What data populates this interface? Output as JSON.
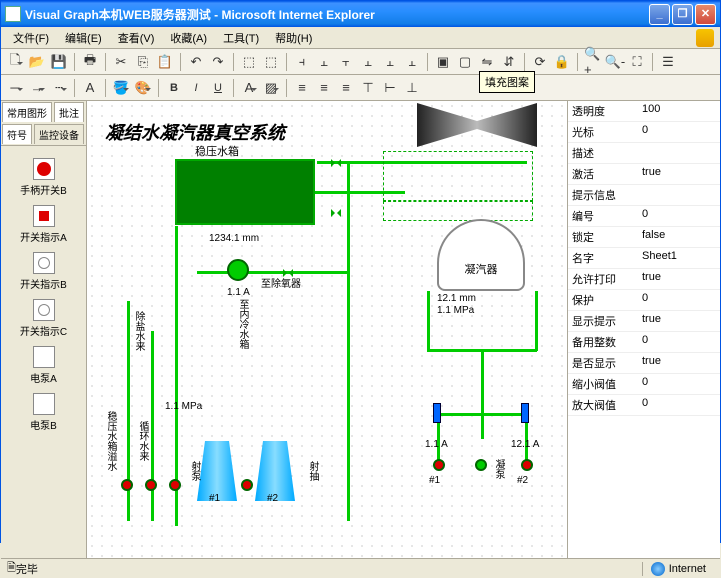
{
  "window": {
    "title": "Visual Graph本机WEB服务器测试 - Microsoft Internet Explorer"
  },
  "menu": {
    "file": "文件(F)",
    "edit": "编辑(E)",
    "view": "查看(V)",
    "fav": "收藏(A)",
    "tools": "工具(T)",
    "help": "帮助(H)"
  },
  "tooltip": "填充图案",
  "tabs": {
    "t1": "常用图形",
    "t2": "批注",
    "t3": "符号",
    "t4": "监控设备"
  },
  "palette": {
    "p1": "手柄开关B",
    "p2": "开关指示A",
    "p3": "开关指示B",
    "p4": "开关指示C",
    "p5": "电泵A",
    "p6": "电泵B"
  },
  "diagram": {
    "title": "凝结水凝汽器真空系统",
    "tank_label": "稳压水箱",
    "measure": "1234.1 mm",
    "amp1": "1.1 A",
    "to_deaerator": "至除氧器",
    "cooling": "至内冷水箱",
    "desalt": "除盐水来",
    "drain": "稳压水箱溢水",
    "circ": "循环水来",
    "jet1": "射泵",
    "jet2": "射抽",
    "n1": "#1",
    "n2": "#2",
    "n1b": "#1",
    "n2b": "#2",
    "pressure": "1.1 MPa",
    "condenser": "凝汽器",
    "cond_m1": "12.1 mm",
    "cond_m2": "1.1 MPa",
    "left_a": "1.1 A",
    "right_a": "12.1 A",
    "condpump": "凝泵"
  },
  "props": [
    {
      "k": "透明度",
      "v": "100"
    },
    {
      "k": "光标",
      "v": "0"
    },
    {
      "k": "描述",
      "v": ""
    },
    {
      "k": "激活",
      "v": "true"
    },
    {
      "k": "提示信息",
      "v": ""
    },
    {
      "k": "编号",
      "v": "0"
    },
    {
      "k": "锁定",
      "v": "false"
    },
    {
      "k": "名字",
      "v": "Sheet1"
    },
    {
      "k": "允许打印",
      "v": "true"
    },
    {
      "k": "保护",
      "v": "0"
    },
    {
      "k": "显示提示",
      "v": "true"
    },
    {
      "k": "备用整数",
      "v": "0"
    },
    {
      "k": "是否显示",
      "v": "true"
    },
    {
      "k": "缩小阀值",
      "v": "0"
    },
    {
      "k": "放大阀值",
      "v": "0"
    }
  ],
  "status": {
    "done": "完毕",
    "zone": "Internet"
  }
}
